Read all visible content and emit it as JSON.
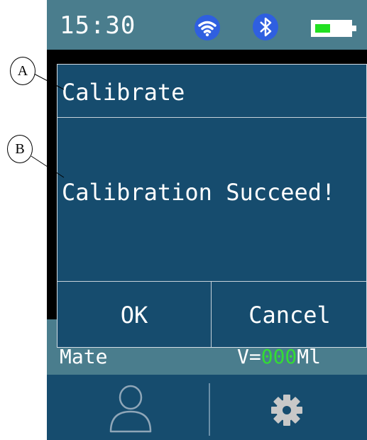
{
  "status_bar": {
    "time": "15:30",
    "icons": [
      "wifi-icon",
      "bluetooth-icon",
      "battery-icon"
    ],
    "battery_level": 0.45,
    "accent_color": "#2f5fe0"
  },
  "info_row": {
    "left_text": "Mate",
    "right_prefix": "V=",
    "right_value": "000",
    "right_unit": "Ml"
  },
  "bottom_bar": {
    "left_icon": "user-icon",
    "right_icon": "gear-icon"
  },
  "dialog": {
    "title": "Calibrate",
    "message": "Calibration Succeed!",
    "ok_label": "OK",
    "cancel_label": "Cancel"
  },
  "callouts": {
    "a": "A",
    "b": "B"
  },
  "colors": {
    "status_bar": "#4a7d8d",
    "dialog_bg": "#164c6e",
    "value_green": "#33dd33"
  }
}
